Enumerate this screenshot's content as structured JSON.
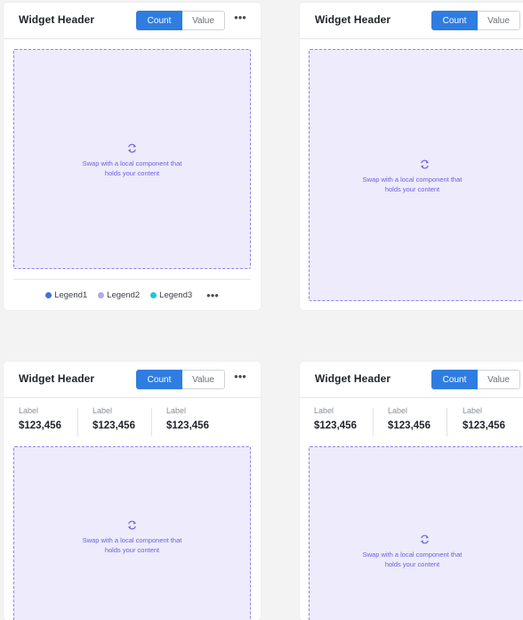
{
  "widgets": [
    {
      "title": "Widget Header",
      "toggle": {
        "count": "Count",
        "value": "Value"
      },
      "more": "•••",
      "placeholder": {
        "line1": "Swap with a local component that",
        "line2": "holds your content"
      },
      "legend": [
        {
          "label": "Legend1",
          "color": "#3f72d6"
        },
        {
          "label": "Legend2",
          "color": "#b5a6f2"
        },
        {
          "label": "Legend3",
          "color": "#1fc7d4"
        }
      ],
      "legend_more": "•••"
    },
    {
      "title": "Widget Header",
      "toggle": {
        "count": "Count",
        "value": "Value"
      },
      "placeholder": {
        "line1": "Swap with a local component that",
        "line2": "holds your content"
      }
    },
    {
      "title": "Widget Header",
      "toggle": {
        "count": "Count",
        "value": "Value"
      },
      "more": "•••",
      "stats": [
        {
          "label": "Label",
          "value": "$123,456"
        },
        {
          "label": "Label",
          "value": "$123,456"
        },
        {
          "label": "Label",
          "value": "$123,456"
        }
      ],
      "placeholder": {
        "line1": "Swap with a local component that",
        "line2": "holds your content"
      }
    },
    {
      "title": "Widget Header",
      "toggle": {
        "count": "Count",
        "value": "Value"
      },
      "stats": [
        {
          "label": "Label",
          "value": "$123,456"
        },
        {
          "label": "Label",
          "value": "$123,456"
        },
        {
          "label": "Label",
          "value": "$123,456"
        }
      ],
      "placeholder": {
        "line1": "Swap with a local component that",
        "line2": "holds your content"
      }
    }
  ],
  "colors": {
    "accent": "#2f7de1",
    "placeholder_bg": "#edebfc",
    "placeholder_border": "#8f86e8",
    "placeholder_text": "#6a5fe0"
  },
  "icons": {
    "swap": "swap-arrows-icon",
    "more": "more-horizontal-icon"
  }
}
